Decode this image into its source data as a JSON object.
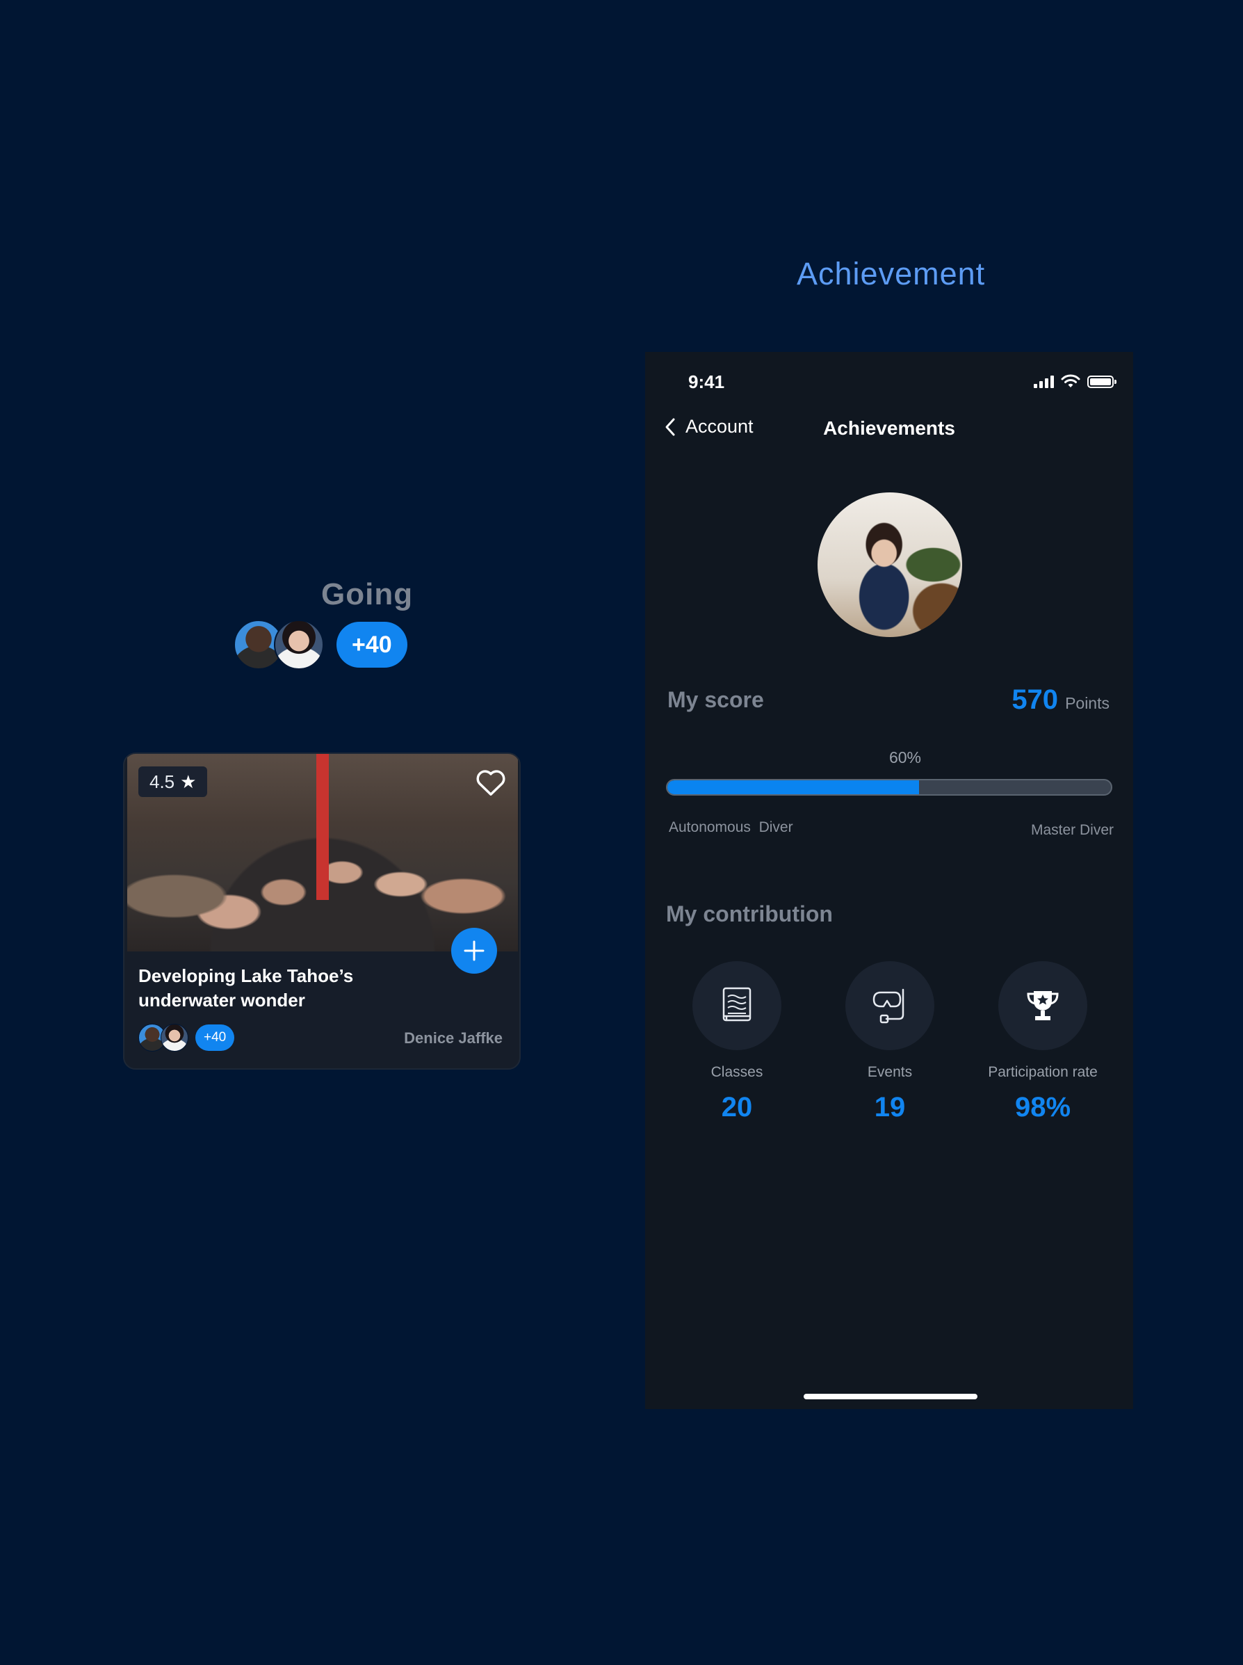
{
  "headings": {
    "achievement": "Achievement",
    "going": "Going"
  },
  "going_group": {
    "count_label": "+40"
  },
  "event_card": {
    "rating": "4.5",
    "title": "Developing Lake Tahoe’s underwater wonder",
    "attendee_count_label": "+40",
    "organizer": "Denice Jaffke"
  },
  "phone": {
    "status_time": "9:41",
    "nav": {
      "back_label": "Account",
      "title": "Achievements"
    },
    "score": {
      "label": "My score",
      "value": "570",
      "unit": "Points"
    },
    "progress": {
      "percent_label": "60%",
      "fraction": 0.6,
      "start_level": "Autonomous  Diver",
      "end_level": "Master Diver"
    },
    "contribution": {
      "label": "My contribution",
      "stats": [
        {
          "icon": "book-icon",
          "label": "Classes",
          "value": "20"
        },
        {
          "icon": "diving-mask-icon",
          "label": "Events",
          "value": "19"
        },
        {
          "icon": "trophy-icon",
          "label": "Participation rate",
          "value": "98%"
        }
      ]
    }
  },
  "colors": {
    "background": "#011633",
    "accent": "#1185f0",
    "heading_blue": "#5d9cf4",
    "phone_background": "#101720"
  }
}
